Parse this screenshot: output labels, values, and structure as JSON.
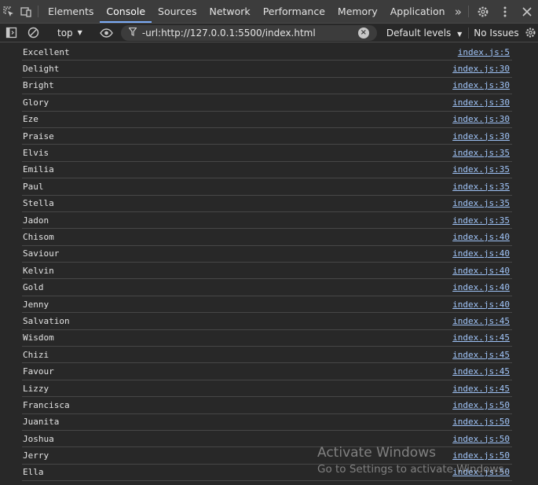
{
  "tabs": [
    "Elements",
    "Console",
    "Sources",
    "Network",
    "Performance",
    "Memory",
    "Application"
  ],
  "active_tab": "Console",
  "toolbar": {
    "context": "top",
    "filter_value": "-url:http://127.0.0.1:5500/index.html",
    "levels": "Default levels",
    "issues": "No Issues"
  },
  "messages": [
    {
      "text": "Excellent",
      "src": "index.js:5"
    },
    {
      "text": "Delight",
      "src": "index.js:30"
    },
    {
      "text": "Bright",
      "src": "index.js:30"
    },
    {
      "text": "Glory",
      "src": "index.js:30"
    },
    {
      "text": "Eze",
      "src": "index.js:30"
    },
    {
      "text": "Praise",
      "src": "index.js:30"
    },
    {
      "text": "Elvis",
      "src": "index.js:35"
    },
    {
      "text": "Emilia",
      "src": "index.js:35"
    },
    {
      "text": "Paul",
      "src": "index.js:35"
    },
    {
      "text": "Stella",
      "src": "index.js:35"
    },
    {
      "text": "Jadon",
      "src": "index.js:35"
    },
    {
      "text": "Chisom",
      "src": "index.js:40"
    },
    {
      "text": "Saviour",
      "src": "index.js:40"
    },
    {
      "text": "Kelvin",
      "src": "index.js:40"
    },
    {
      "text": "Gold",
      "src": "index.js:40"
    },
    {
      "text": "Jenny",
      "src": "index.js:40"
    },
    {
      "text": "Salvation",
      "src": "index.js:45"
    },
    {
      "text": "Wisdom",
      "src": "index.js:45"
    },
    {
      "text": "Chizi",
      "src": "index.js:45"
    },
    {
      "text": "Favour",
      "src": "index.js:45"
    },
    {
      "text": "Lizzy",
      "src": "index.js:45"
    },
    {
      "text": "Francisca",
      "src": "index.js:50"
    },
    {
      "text": "Juanita",
      "src": "index.js:50"
    },
    {
      "text": "Joshua",
      "src": "index.js:50"
    },
    {
      "text": "Jerry",
      "src": "index.js:50"
    },
    {
      "text": "Ella",
      "src": "index.js:50"
    }
  ],
  "watermark": {
    "line1": "Activate Windows",
    "line2": "Go to Settings to activate Windows."
  }
}
